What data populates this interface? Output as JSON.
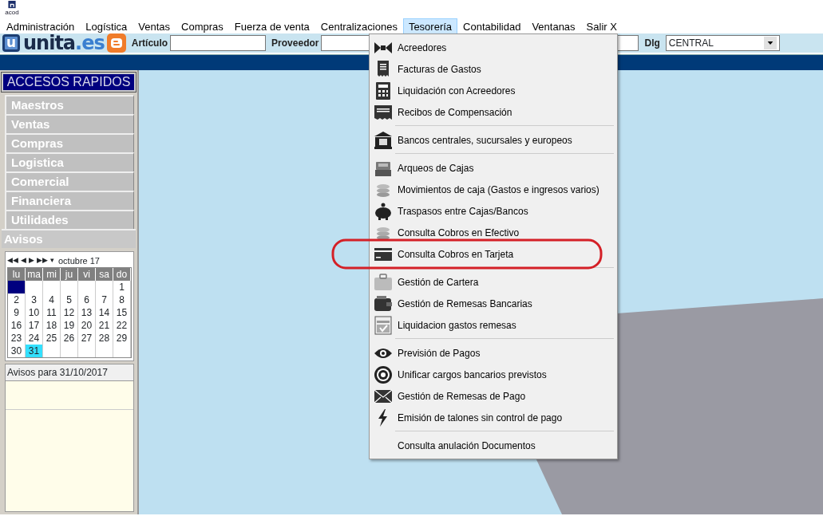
{
  "app_icon_caption": "acod",
  "menu_bar": [
    {
      "label": "Administración",
      "selected": false
    },
    {
      "label": "Logística",
      "selected": false
    },
    {
      "label": "Ventas",
      "selected": false
    },
    {
      "label": "Compras",
      "selected": false
    },
    {
      "label": "Fuerza de venta",
      "selected": false
    },
    {
      "label": "Centralizaciones",
      "selected": false
    },
    {
      "label": "Tesorería",
      "selected": true
    },
    {
      "label": "Contabilidad",
      "selected": false
    },
    {
      "label": "Ventanas",
      "selected": false
    },
    {
      "label": "Salir X",
      "selected": false
    }
  ],
  "toolbar": {
    "logo": {
      "mark": "u",
      "name": "unita",
      "suffix": ".es"
    },
    "fields": [
      {
        "label": "Artículo"
      },
      {
        "label": "Proveedor"
      }
    ],
    "dlg": {
      "label": "Dlg",
      "value": "CENTRAL"
    }
  },
  "sidebar": {
    "title": "ACCESOS RAPIDOS",
    "items": [
      {
        "label": "Maestros"
      },
      {
        "label": "Ventas"
      },
      {
        "label": "Compras"
      },
      {
        "label": "Logistica"
      },
      {
        "label": "Comercial"
      },
      {
        "label": "Financiera"
      },
      {
        "label": "Utilidades"
      }
    ],
    "avisos_tab": "Avisos",
    "calendar": {
      "nav": [
        "◀◀",
        "◀",
        "▶",
        "▶▶",
        "▾"
      ],
      "month": "octubre 17",
      "weekdays": [
        "lu",
        "ma",
        "mi",
        "ju",
        "vi",
        "sa",
        "do"
      ],
      "weeks": [
        [
          {
            "focused": true
          },
          {
            "day": "1",
            "selected": false,
            "focused": false
          }
        ],
        [
          {
            "day": "2",
            "selected": false,
            "focused": false
          },
          {
            "day": "3",
            "selected": false,
            "focused": false
          },
          {
            "day": "4",
            "selected": false,
            "focused": false
          },
          {
            "day": "5",
            "selected": false,
            "focused": false
          },
          {
            "day": "6",
            "selected": false,
            "focused": false
          },
          {
            "day": "7",
            "selected": false,
            "focused": false
          },
          {
            "day": "8",
            "selected": false,
            "focused": false
          }
        ],
        [
          {
            "day": "9",
            "selected": false,
            "focused": false
          },
          {
            "day": "10",
            "selected": false,
            "focused": false
          },
          {
            "day": "11",
            "selected": false,
            "focused": false
          },
          {
            "day": "12",
            "selected": false,
            "focused": false
          },
          {
            "day": "13",
            "selected": false,
            "focused": false
          },
          {
            "day": "14",
            "selected": false,
            "focused": false
          },
          {
            "day": "15",
            "selected": false,
            "focused": false
          }
        ],
        [
          {
            "day": "16",
            "selected": false,
            "focused": false
          },
          {
            "day": "17",
            "selected": false,
            "focused": false
          },
          {
            "day": "18",
            "selected": false,
            "focused": false
          },
          {
            "day": "19",
            "selected": false,
            "focused": false
          },
          {
            "day": "20",
            "selected": false,
            "focused": false
          },
          {
            "day": "21",
            "selected": false,
            "focused": false
          },
          {
            "day": "22",
            "selected": false,
            "focused": false
          }
        ],
        [
          {
            "day": "23",
            "selected": false,
            "focused": false
          },
          {
            "day": "24",
            "selected": false,
            "focused": false
          },
          {
            "day": "25",
            "selected": false,
            "focused": false
          },
          {
            "day": "26",
            "selected": false,
            "focused": false
          },
          {
            "day": "27",
            "selected": false,
            "focused": false
          },
          {
            "day": "28",
            "selected": false,
            "focused": false
          },
          {
            "day": "29",
            "selected": false,
            "focused": false
          }
        ],
        [
          {
            "day": "30",
            "selected": false,
            "focused": false
          },
          {
            "day": "31",
            "selected": true,
            "focused": false
          }
        ]
      ]
    },
    "notices": {
      "title": "Avisos para 31/10/2017"
    }
  },
  "dropdown": {
    "groups": [
      [
        {
          "label": "Acreedores",
          "highlighted": false
        },
        {
          "label": "Facturas de Gastos",
          "highlighted": false
        },
        {
          "label": "Liquidación con Acreedores",
          "highlighted": false
        },
        {
          "label": "Recibos de Compensación",
          "highlighted": false
        }
      ],
      [
        {
          "label": "Bancos centrales, sucursales y europeos",
          "highlighted": false
        }
      ],
      [
        {
          "label": "Arqueos de Cajas",
          "highlighted": false
        },
        {
          "label": "Movimientos de caja (Gastos e ingresos varios)",
          "highlighted": false
        },
        {
          "label": "Traspasos entre Cajas/Bancos",
          "highlighted": false
        },
        {
          "label": "Consulta Cobros en Efectivo",
          "highlighted": false
        },
        {
          "label": "Consulta Cobros en Tarjeta",
          "highlighted": true
        }
      ],
      [
        {
          "label": "Gestión de Cartera",
          "highlighted": false
        },
        {
          "label": "Gestión de Remesas Bancarias",
          "highlighted": false
        },
        {
          "label": "Liquidacion gastos remesas",
          "highlighted": false
        }
      ],
      [
        {
          "label": "Previsión de Pagos",
          "highlighted": false
        },
        {
          "label": "Unificar cargos bancarios previstos",
          "highlighted": false
        },
        {
          "label": "Gestión de Remesas de Pago",
          "highlighted": false
        },
        {
          "label": "Emisión de talones sin control de pago",
          "highlighted": false
        }
      ],
      [
        {
          "label": "Consulta anulación Documentos",
          "highlighted": false
        }
      ]
    ]
  }
}
